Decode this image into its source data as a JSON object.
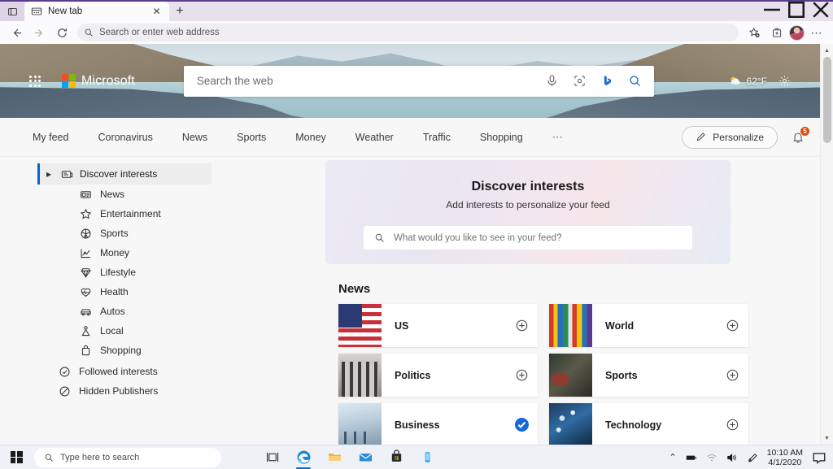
{
  "browser": {
    "tab": {
      "title": "New tab",
      "favicon": "newtab-icon",
      "close": "✕"
    },
    "new_tab_button": "+",
    "window_controls": {
      "minimize": "—",
      "maximize": "❐",
      "close": "✕"
    },
    "toolbar": {
      "back": "back-arrow-icon",
      "forward": "forward-arrow-icon",
      "refresh": "refresh-icon",
      "address_placeholder": "Search or enter web address",
      "address_value": "",
      "favorites": "favorites-star-icon",
      "collections": "collections-icon",
      "profile": "profile-avatar",
      "settings_more": "⋯"
    }
  },
  "hero": {
    "waffle": "app-launcher-icon",
    "brand": "Microsoft",
    "search_placeholder": "Search the web",
    "search_value": "",
    "icons": {
      "mic": "microphone-icon",
      "visual": "visual-search-icon",
      "bing": "bing-chat-icon",
      "search": "search-icon"
    },
    "weather_temp": "62°F",
    "weather_icon": "partly-cloudy-icon",
    "settings_icon": "gear-icon"
  },
  "nav": {
    "items": [
      {
        "label": "My feed"
      },
      {
        "label": "Coronavirus"
      },
      {
        "label": "News"
      },
      {
        "label": "Sports"
      },
      {
        "label": "Money"
      },
      {
        "label": "Weather"
      },
      {
        "label": "Traffic"
      },
      {
        "label": "Shopping"
      }
    ],
    "more": "⋯",
    "personalize_label": "Personalize",
    "notification_count": "5"
  },
  "sidebar": {
    "header": {
      "label": "Discover interests",
      "caret": "▶",
      "icon": "discover-icon"
    },
    "interests": [
      {
        "label": "News",
        "icon": "news-icon"
      },
      {
        "label": "Entertainment",
        "icon": "star-icon"
      },
      {
        "label": "Sports",
        "icon": "basketball-icon"
      },
      {
        "label": "Money",
        "icon": "chart-line-icon"
      },
      {
        "label": "Lifestyle",
        "icon": "diamond-icon"
      },
      {
        "label": "Health",
        "icon": "heart-pulse-icon"
      },
      {
        "label": "Autos",
        "icon": "car-icon"
      },
      {
        "label": "Local",
        "icon": "location-person-icon"
      },
      {
        "label": "Shopping",
        "icon": "shopping-bag-icon"
      }
    ],
    "footer": [
      {
        "label": "Followed interests",
        "icon": "check-circle-icon"
      },
      {
        "label": "Hidden Publishers",
        "icon": "block-circle-icon"
      }
    ]
  },
  "discover_card": {
    "title": "Discover interests",
    "subtitle": "Add interests to personalize your feed",
    "search_placeholder": "What would you like to see in your feed?",
    "search_value": ""
  },
  "news_section": {
    "title": "News",
    "tiles": [
      {
        "name": "US",
        "thumb": "us-flag-thumb",
        "state": "add",
        "action_icon": "plus-circle-icon"
      },
      {
        "name": "World",
        "thumb": "world-flags-thumb",
        "state": "add",
        "action_icon": "plus-circle-icon"
      },
      {
        "name": "Politics",
        "thumb": "capitol-columns-thumb",
        "state": "add",
        "action_icon": "plus-circle-icon"
      },
      {
        "name": "Sports",
        "thumb": "sports-gear-thumb",
        "state": "add",
        "action_icon": "plus-circle-icon"
      },
      {
        "name": "Business",
        "thumb": "office-lobby-thumb",
        "state": "followed",
        "action_icon": "check-circle-filled-icon"
      },
      {
        "name": "Technology",
        "thumb": "fiber-optics-thumb",
        "state": "add",
        "action_icon": "plus-circle-icon"
      }
    ]
  },
  "taskbar": {
    "start": "windows-start-icon",
    "search_placeholder": "Type here to search",
    "pinned": [
      {
        "name": "task-view-icon"
      },
      {
        "name": "microsoft-edge-icon",
        "active": true
      },
      {
        "name": "file-explorer-icon"
      },
      {
        "name": "mail-icon"
      },
      {
        "name": "microsoft-store-icon"
      },
      {
        "name": "phone-link-icon"
      }
    ],
    "tray": {
      "overflow": "⌃",
      "battery": "battery-icon",
      "network": "wifi-icon",
      "volume": "volume-icon",
      "pen": "pen-icon",
      "time": "10:10 AM",
      "date": "4/1/2020",
      "action_center": "action-center-icon"
    }
  },
  "colors": {
    "accent": "#0b63ce",
    "badge": "#d8500f",
    "followed": "#1668d9",
    "titlebar": "#e8e2ee",
    "purple_border": "#5a3e8e"
  }
}
